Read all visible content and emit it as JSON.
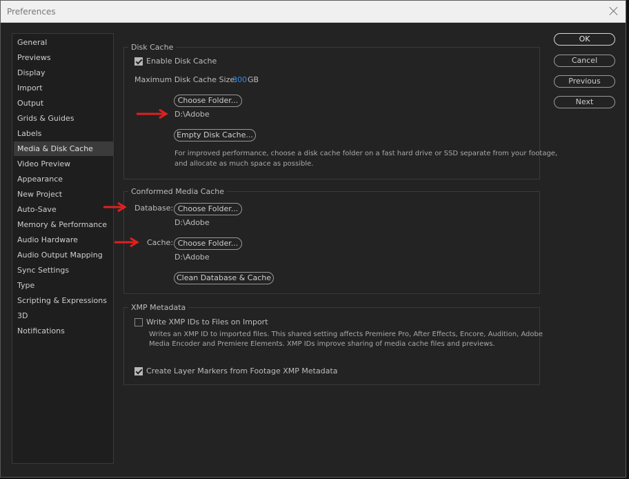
{
  "window": {
    "title": "Preferences"
  },
  "sidebar": {
    "items": [
      {
        "label": "General"
      },
      {
        "label": "Previews"
      },
      {
        "label": "Display"
      },
      {
        "label": "Import"
      },
      {
        "label": "Output"
      },
      {
        "label": "Grids & Guides"
      },
      {
        "label": "Labels"
      },
      {
        "label": "Media & Disk Cache",
        "selected": true
      },
      {
        "label": "Video Preview"
      },
      {
        "label": "Appearance"
      },
      {
        "label": "New Project"
      },
      {
        "label": "Auto-Save"
      },
      {
        "label": "Memory & Performance"
      },
      {
        "label": "Audio Hardware"
      },
      {
        "label": "Audio Output Mapping"
      },
      {
        "label": "Sync Settings"
      },
      {
        "label": "Type"
      },
      {
        "label": "Scripting & Expressions"
      },
      {
        "label": "3D"
      },
      {
        "label": "Notifications"
      }
    ]
  },
  "disk_cache": {
    "title": "Disk Cache",
    "enable_label": "Enable Disk Cache",
    "enable_checked": true,
    "max_size_label": "Maximum Disk Cache Size:",
    "max_size_value": "300",
    "max_size_unit": "GB",
    "choose_folder": "Choose Folder...",
    "folder_path": "D:\\Adobe",
    "empty_cache": "Empty Disk Cache...",
    "hint_line1": "For improved performance, choose a disk cache folder on a fast hard drive or SSD separate from your footage,",
    "hint_line2": "and allocate as much space as possible."
  },
  "conformed": {
    "title": "Conformed Media Cache",
    "database_label": "Database:",
    "database_button": "Choose Folder...",
    "database_path": "D:\\Adobe",
    "cache_label": "Cache:",
    "cache_button": "Choose Folder...",
    "cache_path": "D:\\Adobe",
    "clean_button": "Clean Database & Cache"
  },
  "xmp": {
    "title": "XMP Metadata",
    "write_label": "Write XMP IDs to Files on Import",
    "write_checked": false,
    "write_desc1": "Writes an XMP ID to imported files. This shared setting affects Premiere Pro, After Effects, Encore, Audition, Adobe",
    "write_desc2": "Media Encoder and Premiere Elements. XMP IDs improve sharing of media cache files and previews.",
    "markers_label": "Create Layer Markers from Footage XMP Metadata",
    "markers_checked": true
  },
  "buttons": {
    "ok": "OK",
    "cancel": "Cancel",
    "previous": "Previous",
    "next": "Next"
  },
  "colors": {
    "accent_value": "#2d8ceb",
    "annotation_arrow": "#e02020"
  }
}
